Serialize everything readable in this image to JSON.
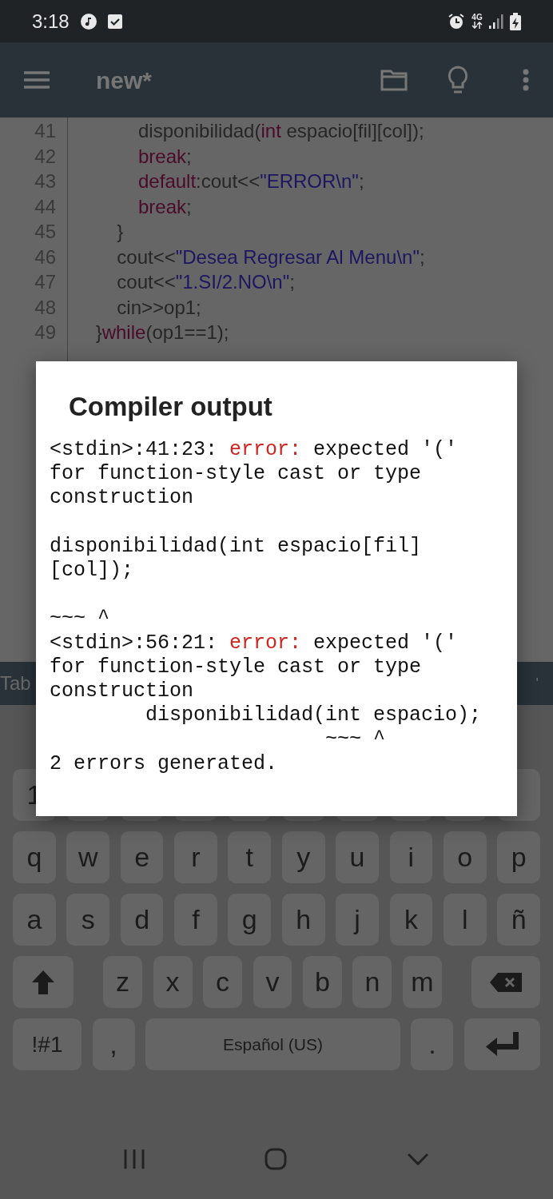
{
  "status_bar": {
    "time": "3:18",
    "network": "4G"
  },
  "toolbar": {
    "title": "new*"
  },
  "code": {
    "lines": [
      {
        "number": "41",
        "tokens": [
          {
            "text": "            disponibilidad(",
            "kind": "plain"
          },
          {
            "text": "int",
            "kind": "keyword"
          },
          {
            "text": " espacio[fil][col]);",
            "kind": "plain"
          }
        ]
      },
      {
        "number": "42",
        "tokens": [
          {
            "text": "            break",
            "kind": "keyword"
          },
          {
            "text": ";",
            "kind": "plain"
          }
        ]
      },
      {
        "number": "43",
        "tokens": [
          {
            "text": "            default",
            "kind": "keyword"
          },
          {
            "text": ":cout<<",
            "kind": "plain"
          },
          {
            "text": "\"ERROR\\n\"",
            "kind": "string"
          },
          {
            "text": ";",
            "kind": "plain"
          }
        ]
      },
      {
        "number": "44",
        "tokens": [
          {
            "text": "            break",
            "kind": "keyword"
          },
          {
            "text": ";",
            "kind": "plain"
          }
        ]
      },
      {
        "number": "45",
        "tokens": [
          {
            "text": "        }",
            "kind": "plain"
          }
        ]
      },
      {
        "number": "46",
        "tokens": [
          {
            "text": "        cout<<",
            "kind": "plain"
          },
          {
            "text": "\"Desea Regresar Al Menu\\n\"",
            "kind": "string"
          },
          {
            "text": ";",
            "kind": "plain"
          }
        ]
      },
      {
        "number": "47",
        "tokens": [
          {
            "text": "        cout<<",
            "kind": "plain"
          },
          {
            "text": "\"1.SI/2.NO\\n\"",
            "kind": "string"
          },
          {
            "text": ";",
            "kind": "plain"
          }
        ]
      },
      {
        "number": "48",
        "tokens": [
          {
            "text": "        cin>>op1;",
            "kind": "plain"
          }
        ]
      },
      {
        "number": "49",
        "tokens": [
          {
            "text": "    }",
            "kind": "plain"
          },
          {
            "text": "while",
            "kind": "keyword"
          },
          {
            "text": "(op1==1);",
            "kind": "plain"
          }
        ]
      }
    ]
  },
  "extra_keys": {
    "left": "Tab",
    "right": "'"
  },
  "dialog": {
    "title": "Compiler output",
    "output": [
      {
        "text": "<stdin>:41:23: ",
        "kind": "plain"
      },
      {
        "text": "error:",
        "kind": "error"
      },
      {
        "text": " expected '('\nfor function-style cast or type\nconstruction\n\ndisponibilidad(int espacio[fil]\n[col]);\n\n~~~ ^\n<stdin>:56:21: ",
        "kind": "plain"
      },
      {
        "text": "error:",
        "kind": "error"
      },
      {
        "text": " expected '('\nfor function-style cast or type\nconstruction\n        disponibilidad(int espacio);\n                       ~~~ ^\n2 errors generated.",
        "kind": "plain"
      }
    ]
  },
  "keyboard": {
    "number_row": {
      "first": "1"
    },
    "rows": [
      [
        "q",
        "w",
        "e",
        "r",
        "t",
        "y",
        "u",
        "i",
        "o",
        "p"
      ],
      [
        "a",
        "s",
        "d",
        "f",
        "g",
        "h",
        "j",
        "k",
        "l",
        "ñ"
      ],
      [
        "z",
        "x",
        "c",
        "v",
        "b",
        "n",
        "m"
      ]
    ],
    "symbols": "!#1",
    "comma": ",",
    "space": "Español (US)",
    "period": "."
  }
}
